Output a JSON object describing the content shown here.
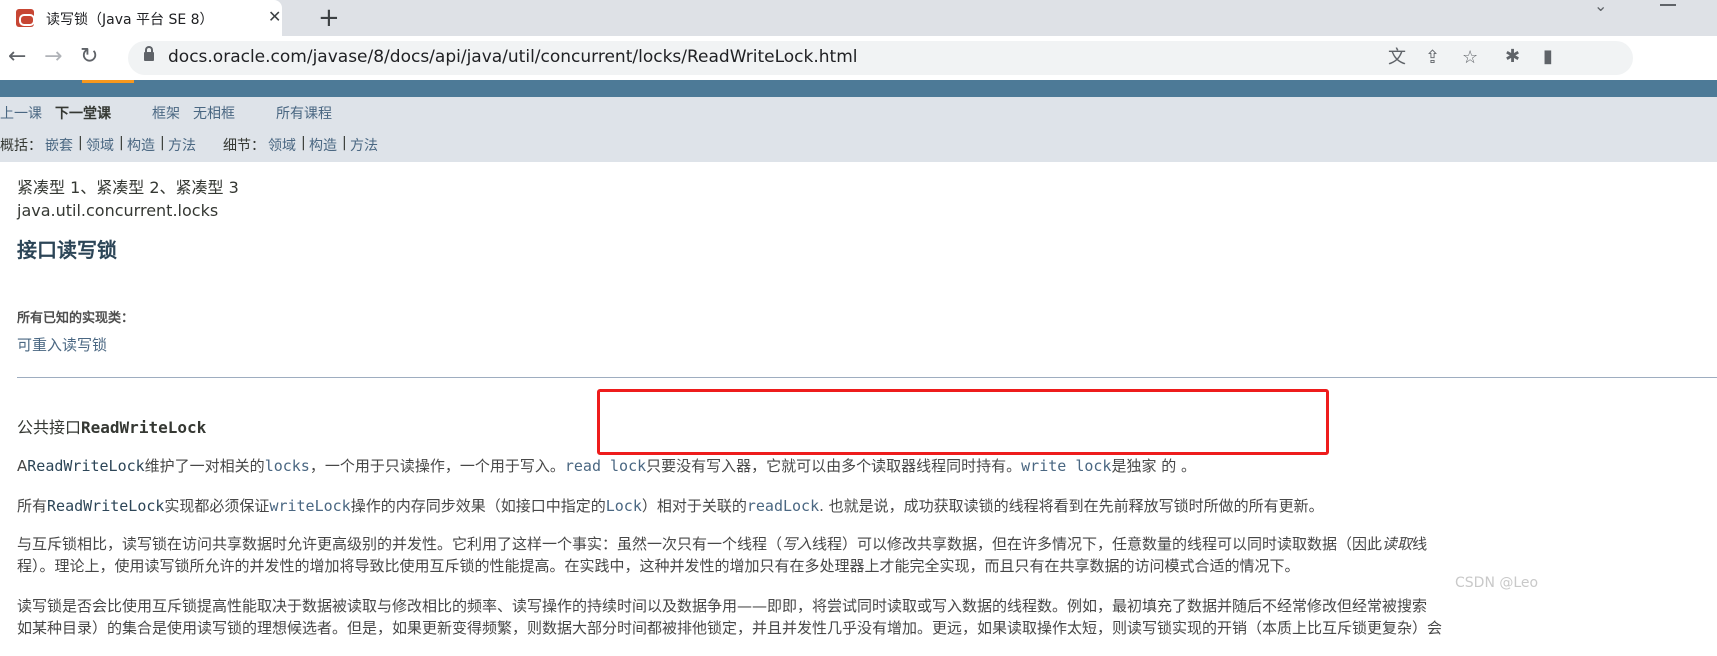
{
  "browser": {
    "tab_title": "读写锁（Java 平台 SE 8）",
    "tab_close": "✕",
    "new_tab": "+",
    "url": "docs.oracle.com/javase/8/docs/api/java/util/concurrent/locks/ReadWriteLock.html",
    "back": "←",
    "forward": "→",
    "reload": "↻"
  },
  "nav": {
    "prev_class": "上一课",
    "next_class": "下一堂课",
    "frames": "框架",
    "no_frames": "无相框",
    "all_classes": "所有课程",
    "summary_label": "概括：",
    "summary_items": [
      "嵌套",
      "领域",
      "构造",
      "方法"
    ],
    "detail_label": "细节：",
    "detail_items": [
      "领域",
      "构造",
      "方法"
    ],
    "sep": "|"
  },
  "content": {
    "profiles": "紧凑型 1、紧凑型 2、紧凑型 3",
    "package": "java.util.concurrent.locks",
    "title": "接口读写锁",
    "impl_label": "所有已知的实现类：",
    "impl_link": "可重入读写锁",
    "decl_prefix": "公共接口",
    "decl_name": "ReadWriteLock",
    "p1": {
      "a": "A",
      "b": "ReadWriteLock",
      "c": "维护了一对相关的",
      "d": "locks",
      "e": "，一个用于只读操作，一个用于写入。",
      "f": "read lock",
      "g": "只要没有写入器，它就可以由多个读取器线程同时持有。",
      "h": "write lock",
      "i": "是独家 的 。"
    },
    "p2": {
      "a": "所有",
      "b": "ReadWriteLock",
      "c": "实现都必须保证",
      "d": "writeLock",
      "e": "操作的内存同步效果（如接口中指定的",
      "f": "Lock",
      "g": "）相对于关联的",
      "h": "readLock",
      "i": ". 也就是说，成功获取读锁的线程将看到在先前释放写锁时所做的所有更新。"
    },
    "p3a_a": "与互斥锁相比，读写锁在访问共享数据时允许更高级别的并发性。它利用了这样一个事实：虽然一次只有一个线程（",
    "p3a_em": "写入",
    "p3a_b": "线程）可以修改共享数据，但在许多情况下，任意数量的线程可以同时读取数据（因此",
    "p3a_em2": "读取",
    "p3a_c": "线",
    "p3b": "程）。理论上，使用读写锁所允许的并发性的增加将导致比使用互斥锁的性能提高。在实践中，这种并发性的增加只有在多处理器上才能完全实现，而且只有在共享数据的访问模式合适的情况下。",
    "p4a": "读写锁是否会比使用互斥锁提高性能取决于数据被读取与修改相比的频率、读写操作的持续时间以及数据争用——即即，将尝试同时读取或写入数据的线程数。例如，最初填充了数据并随后不经常修改但经常被搜索",
    "p4b": "如某种目录）的集合是使用读写锁的理想候选者。但是，如果更新变得频繁，则数据大部分时间都被排他锁定，并且并发性几乎没有增加。更远，如果读取操作太短，则读写锁实现的开销（本质上比互斥锁更复杂）会",
    "watermark": "CSDN @Leo"
  },
  "colors": {
    "topbar": "#4d7a97",
    "subnav": "#dee3e9",
    "link": "#4a6782",
    "highlight": "#ee1c1c"
  }
}
